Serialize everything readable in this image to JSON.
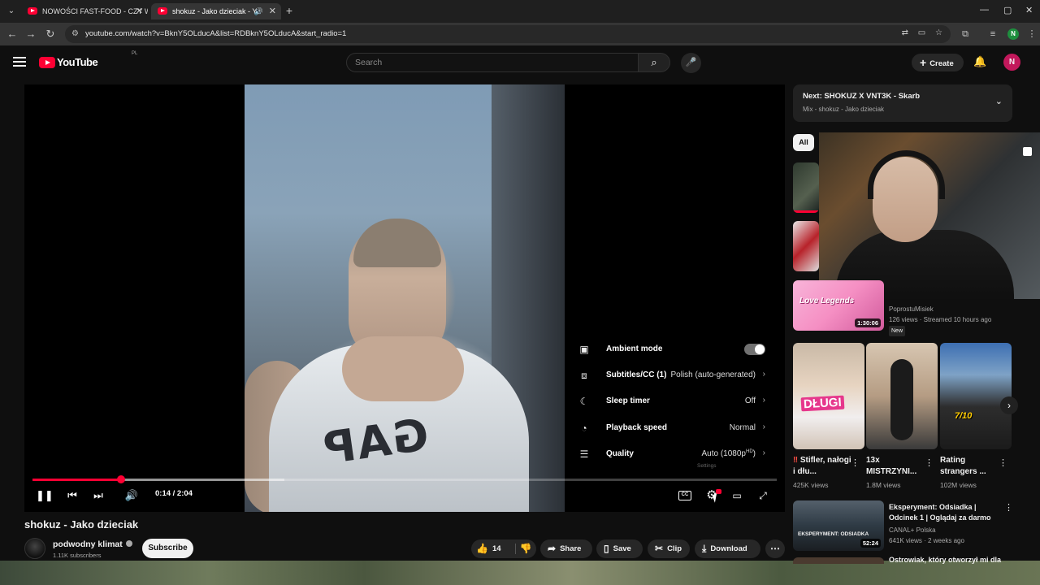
{
  "browser": {
    "tabs": [
      {
        "title": "NOWOŚCI FAST-FOOD - CZY W"
      },
      {
        "title": "shokuz - Jako dzieciak - Yo"
      }
    ],
    "url": "youtube.com/watch?v=BknY5OLducA&list=RDBknY5OLducA&start_radio=1",
    "profile_initial": "N"
  },
  "header": {
    "logo_text": "YouTube",
    "country_code": "PL",
    "search_placeholder": "Search",
    "create_label": "Create",
    "avatar_initial": "N"
  },
  "player": {
    "time": "0:14 / 2:04",
    "progress_played_fraction": 0.119,
    "progress_buffered_fraction": 0.338,
    "cc_label": "CC",
    "settings_tooltip": "Settings",
    "settings_menu": {
      "ambient_mode": {
        "label": "Ambient mode",
        "on": true
      },
      "subtitles": {
        "label": "Subtitles/CC (1)",
        "value": "Polish (auto-generated)"
      },
      "sleep_timer": {
        "label": "Sleep timer",
        "value": "Off"
      },
      "playback_speed": {
        "label": "Playback speed",
        "value": "Normal"
      },
      "quality": {
        "label": "Quality",
        "value": "Auto (1080p",
        "value_suffix": "HD",
        "value_close": ")"
      }
    }
  },
  "video": {
    "title": "shokuz - Jako dzieciak",
    "channel": "podwodny klimat",
    "subscribers": "1.11K subscribers",
    "subscribe_label": "Subscribe",
    "likes": "14",
    "share_label": "Share",
    "save_label": "Save",
    "clip_label": "Clip",
    "download_label": "Download"
  },
  "sidebar": {
    "next": {
      "title": "Next: SHOKUZ X VNT3K - Skarb",
      "subtitle": "Mix - shokuz - Jako dzieciak"
    },
    "chip_all": "All",
    "live_card": {
      "thumb_text": "Love Legends",
      "duration": "1:30:06",
      "channel": "PoprostuMisiek",
      "meta": "126 views · Streamed 10 hours ago",
      "badge": "New"
    },
    "shorts": [
      {
        "thumb_text": "DŁUGI",
        "warn": "‼",
        "title": "Stifler, nałogi i dłu...",
        "views": "425K views"
      },
      {
        "thumb_text": "",
        "title": "13x MISTRZYNI...",
        "views": "1.8M views"
      },
      {
        "thumb_text": "7/10",
        "title": "Rating strangers ...",
        "views": "102M views"
      }
    ],
    "related": {
      "thumb_text": "EKSPERYMENT: ODSIADKA",
      "duration": "52:24",
      "title": "Eksperyment: Odsiadka | Odcinek 1 | Oglądaj za darmo",
      "channel": "CANAL+ Polska",
      "meta": "641K views · 2 weeks ago"
    },
    "related_next_title": "Ostrowiak, który otworzył mi dla"
  }
}
